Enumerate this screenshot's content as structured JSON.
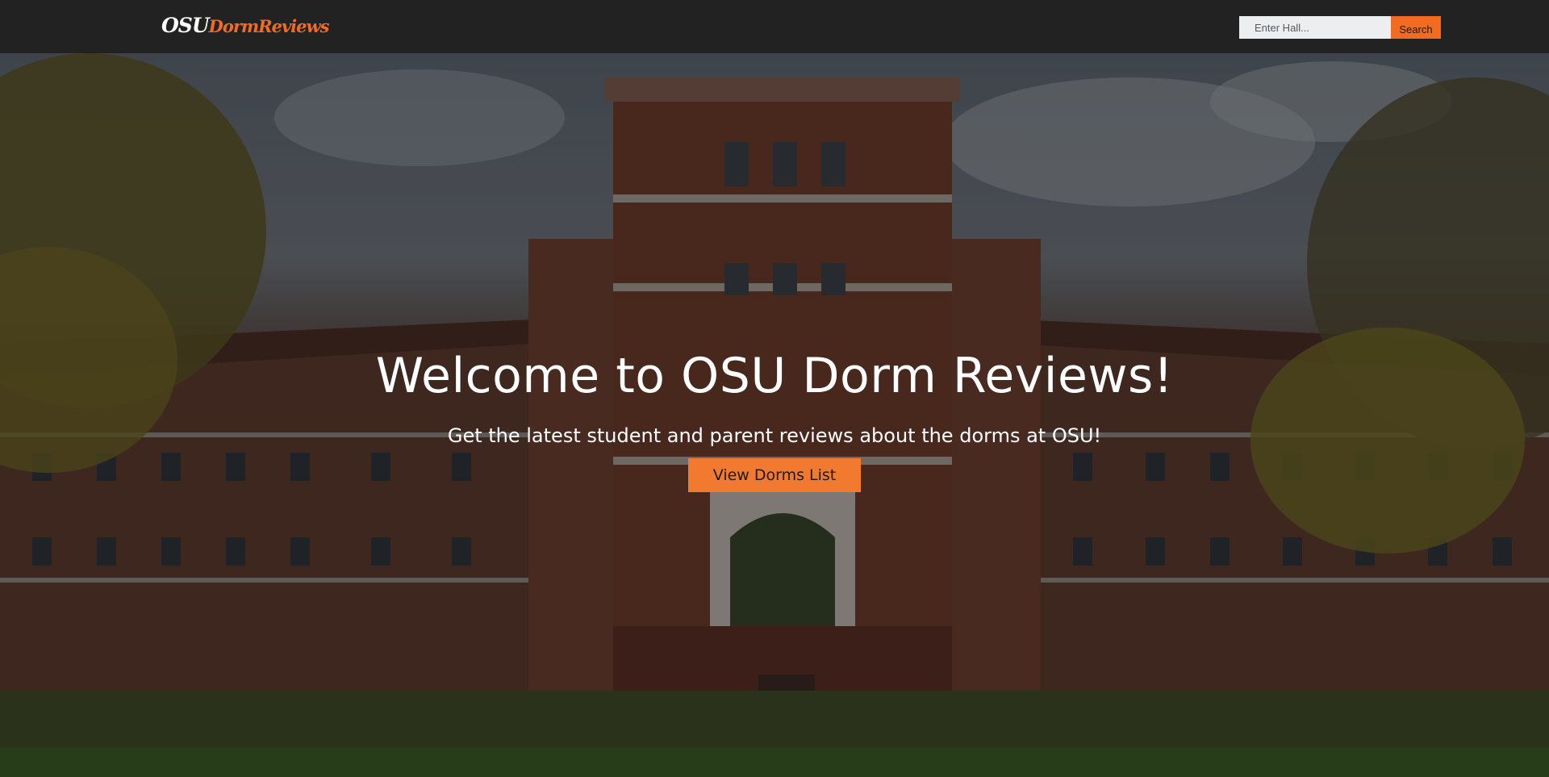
{
  "navbar": {
    "logo_osu": "OSU",
    "logo_rest": "DormReviews",
    "search_placeholder": "Enter Hall...",
    "search_button": "Search"
  },
  "hero": {
    "title": "Welcome to OSU Dorm Reviews!",
    "subtitle": "Get the latest student and parent reviews about the dorms at OSU!",
    "cta_button": "View Dorms List",
    "background_image": "brick-dormitory-building-photo"
  },
  "colors": {
    "navbar_bg": "#222222",
    "accent": "#f26b21",
    "button": "#f27a30",
    "text_light": "#ffffff"
  }
}
